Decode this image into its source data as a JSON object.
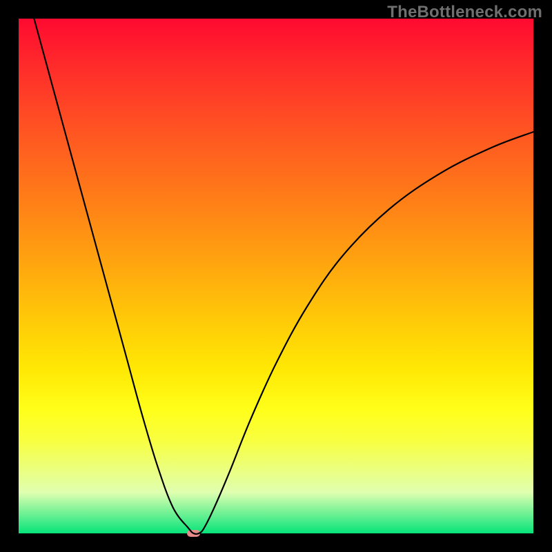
{
  "watermark": "TheBottleneck.com",
  "chart_data": {
    "type": "line",
    "title": "",
    "xlabel": "",
    "ylabel": "",
    "xlim": [
      0,
      100
    ],
    "ylim": [
      0,
      100
    ],
    "grid": false,
    "legend": false,
    "background_gradient": {
      "top": "#ff0a30",
      "bottom": "#06e47a",
      "meaning": "red=high bottleneck, green=no bottleneck"
    },
    "series": [
      {
        "name": "bottleneck-curve",
        "x": [
          3,
          6,
          9,
          12,
          15,
          18,
          21,
          24,
          27,
          30,
          33,
          34,
          35,
          36,
          38,
          41,
          45,
          50,
          56,
          63,
          72,
          82,
          92,
          100
        ],
        "values": [
          100,
          89,
          78,
          67,
          56,
          45,
          34,
          23,
          13,
          5,
          1,
          0,
          0,
          1,
          5,
          12,
          22,
          33,
          44,
          54,
          63,
          70,
          75,
          78
        ]
      }
    ],
    "marker": {
      "name": "optimal-point",
      "x": 34,
      "y": 0,
      "width_x_units": 2.6,
      "height_y_units": 1.3,
      "color": "#e68a8a"
    }
  }
}
